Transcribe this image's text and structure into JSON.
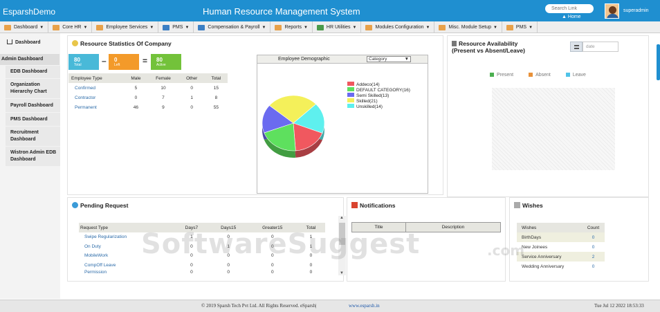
{
  "header": {
    "app_name": "EsparshDemo",
    "system_title": "Human Resource Management System",
    "search_placeholder": "Search Link",
    "home_label": "Home",
    "user": "superadmin"
  },
  "menu": [
    "Dashboard",
    "Core HR",
    "Employee Services",
    "PMS",
    "Compensation & Payroll",
    "Reports",
    "HR Utilities",
    "Modules Configuration",
    "Misc. Module Setup",
    "PMS"
  ],
  "sidebar": {
    "title": "Dashboard",
    "items": [
      "Admin Dashboard",
      "EDB Dashboard",
      "Organization Hierarchy Chart",
      "Payroll Dashboard",
      "PMS Dashboard",
      "Recruitment Dashboard",
      "Wistron Admin EDB Dashboard"
    ]
  },
  "resource_stats": {
    "title": "Resource Statistics Of Company",
    "cards": [
      {
        "value": "80",
        "label": "Total",
        "color": "#49b9d8"
      },
      {
        "value": "0",
        "label": "Left",
        "color": "#f39a2a"
      },
      {
        "value": "80",
        "label": "Active",
        "color": "#73c23a"
      }
    ],
    "operators": [
      "–",
      "="
    ],
    "table": {
      "headers": [
        "Employee Type",
        "Male",
        "Female",
        "Other",
        "Total"
      ],
      "rows": [
        [
          "Confirmed",
          "5",
          "10",
          "0",
          "15"
        ],
        [
          "Contractor",
          "0",
          "7",
          "1",
          "8"
        ],
        [
          "Permanent",
          "46",
          "9",
          "0",
          "55"
        ]
      ]
    }
  },
  "demographic": {
    "title": "Employee Demographic",
    "select_value": "Category"
  },
  "chart_data": {
    "type": "pie",
    "categories": [
      "Addeco",
      "DEFAULT CATEGORY",
      "Semi Skilled",
      "Skilled",
      "Unskilled"
    ],
    "values": [
      14,
      16,
      13,
      21,
      14
    ],
    "legend_labels": [
      "Addeco(14)",
      "DEFAULT CATEGORY(16)",
      "Semi Skilled(13)",
      "Skilled(21)",
      "Unskilled(14)"
    ],
    "colors": [
      "#f0585f",
      "#5ee05e",
      "#6b6bf0",
      "#f4f05a",
      "#5ef0ee"
    ],
    "legend": "right"
  },
  "availability": {
    "title": "Resource Availability",
    "subtitle": "(Present vs Absent/Leave)",
    "date_placeholder": "date",
    "legend": [
      {
        "label": "Present",
        "color": "#4caf50"
      },
      {
        "label": "Absent",
        "color": "#e8913a"
      },
      {
        "label": "Leave",
        "color": "#4fc3e8"
      }
    ]
  },
  "pending": {
    "title": "Pending Request",
    "headers": [
      "Request Type",
      "Days7",
      "Days15",
      "Greater15",
      "Total"
    ],
    "rows": [
      [
        "Swipe Regularization",
        "1",
        "0",
        "0",
        "1"
      ],
      [
        "On Duty",
        "0",
        "1",
        "0",
        "1"
      ],
      [
        "MobileWork",
        "0",
        "0",
        "0",
        "0"
      ],
      [
        "CompOff Leave",
        "0",
        "0",
        "0",
        "0"
      ],
      [
        "Permission",
        "0",
        "0",
        "0",
        "0"
      ]
    ]
  },
  "notifications": {
    "title": "Notifications",
    "headers": [
      "Title",
      "Description"
    ]
  },
  "wishes": {
    "title": "Wishes",
    "headers": [
      "Wishes",
      "Count"
    ],
    "rows": [
      [
        "BirthDays",
        "0"
      ],
      [
        "New Joinees",
        "0"
      ],
      [
        "Service Anniversary",
        "2"
      ],
      [
        "Wedding Anniversary",
        "0"
      ]
    ]
  },
  "footer": {
    "copyright": "© 2019 Sparsh Tech Pvt Ltd. All Rights Reserved. eSparsh|",
    "site": "www.esparsh.in",
    "datetime": "Tue Jul 12 2022 18:53:33"
  },
  "watermark": {
    "text": "SoftwareSuggest",
    ".com": ".com"
  }
}
